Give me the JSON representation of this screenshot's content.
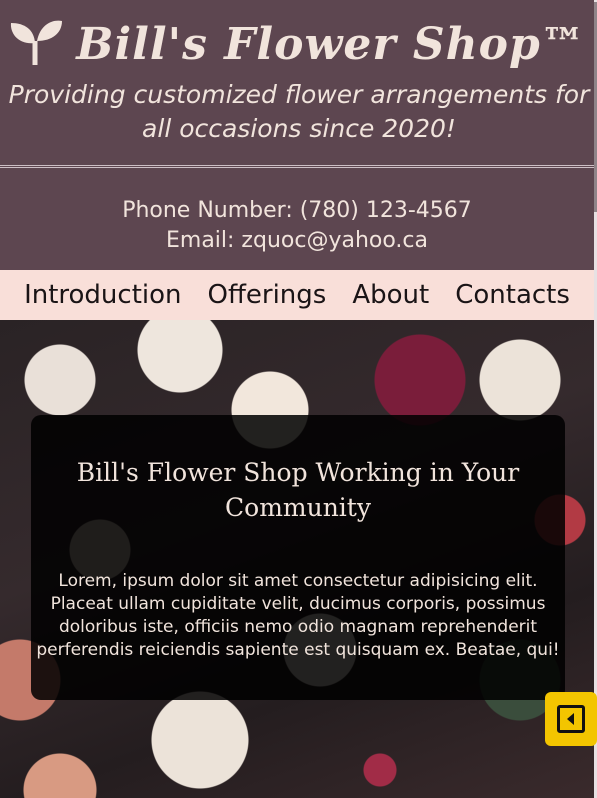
{
  "header": {
    "logo_icon": "sprout-icon",
    "brand_title": "Bill's Flower Shop™",
    "tagline": "Providing customized flower arrangements for all occasions since 2020!"
  },
  "contact": {
    "phone": "Phone Number:  (780) 123-4567",
    "email": "Email: zquoc@yahoo.ca"
  },
  "nav": {
    "items": [
      {
        "label": "Introduction"
      },
      {
        "label": "Offerings"
      },
      {
        "label": "About"
      },
      {
        "label": "Contacts"
      }
    ]
  },
  "hero": {
    "title": "Bill's Flower Shop Working in Your Community",
    "text": "Lorem, ipsum dolor sit amet consectetur adipisicing elit. Placeat ullam cupiditate velit, ducimus corporis, possimus doloribus iste, officiis nemo odio magnam reprehenderit perferendis reiciendis sapiente est quisquam ex. Beatae, qui!"
  },
  "fab": {
    "icon": "collapse-left-icon"
  },
  "colors": {
    "header_bg": "#5d4650",
    "nav_bg": "#f9dfd9",
    "text_light": "#f1e4dc",
    "fab_bg": "#f3c500"
  }
}
